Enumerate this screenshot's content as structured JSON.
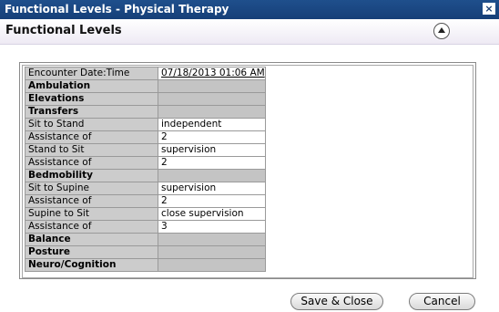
{
  "window": {
    "title": "Functional Levels - Physical Therapy",
    "close_glyph": "×"
  },
  "header": {
    "title": "Functional Levels"
  },
  "rows": [
    {
      "label": "Encounter Date:Time",
      "value": "07/18/2013 01:06 AM",
      "bold": false,
      "gray": false,
      "date": true
    },
    {
      "label": "Ambulation",
      "value": "",
      "bold": true,
      "gray": true
    },
    {
      "label": "Elevations",
      "value": "",
      "bold": true,
      "gray": true
    },
    {
      "label": "Transfers",
      "value": "",
      "bold": true,
      "gray": true
    },
    {
      "label": "Sit to Stand",
      "value": "independent",
      "bold": false,
      "gray": false
    },
    {
      "label": "Assistance of",
      "value": "2",
      "bold": false,
      "gray": false
    },
    {
      "label": "Stand to Sit",
      "value": "supervision",
      "bold": false,
      "gray": false
    },
    {
      "label": "Assistance of",
      "value": "2",
      "bold": false,
      "gray": false
    },
    {
      "label": "Bedmobility",
      "value": "",
      "bold": true,
      "gray": true
    },
    {
      "label": "Sit to Supine",
      "value": "supervision",
      "bold": false,
      "gray": false
    },
    {
      "label": "Assistance of",
      "value": "2",
      "bold": false,
      "gray": false
    },
    {
      "label": "Supine to Sit",
      "value": "close supervision",
      "bold": false,
      "gray": false
    },
    {
      "label": "Assistance of",
      "value": "3",
      "bold": false,
      "gray": false
    },
    {
      "label": "Balance",
      "value": "",
      "bold": true,
      "gray": true
    },
    {
      "label": "Posture",
      "value": "",
      "bold": true,
      "gray": true
    },
    {
      "label": "Neuro/Cognition",
      "value": "",
      "bold": true,
      "gray": true
    }
  ],
  "buttons": {
    "save_close": "Save & Close",
    "cancel": "Cancel"
  }
}
